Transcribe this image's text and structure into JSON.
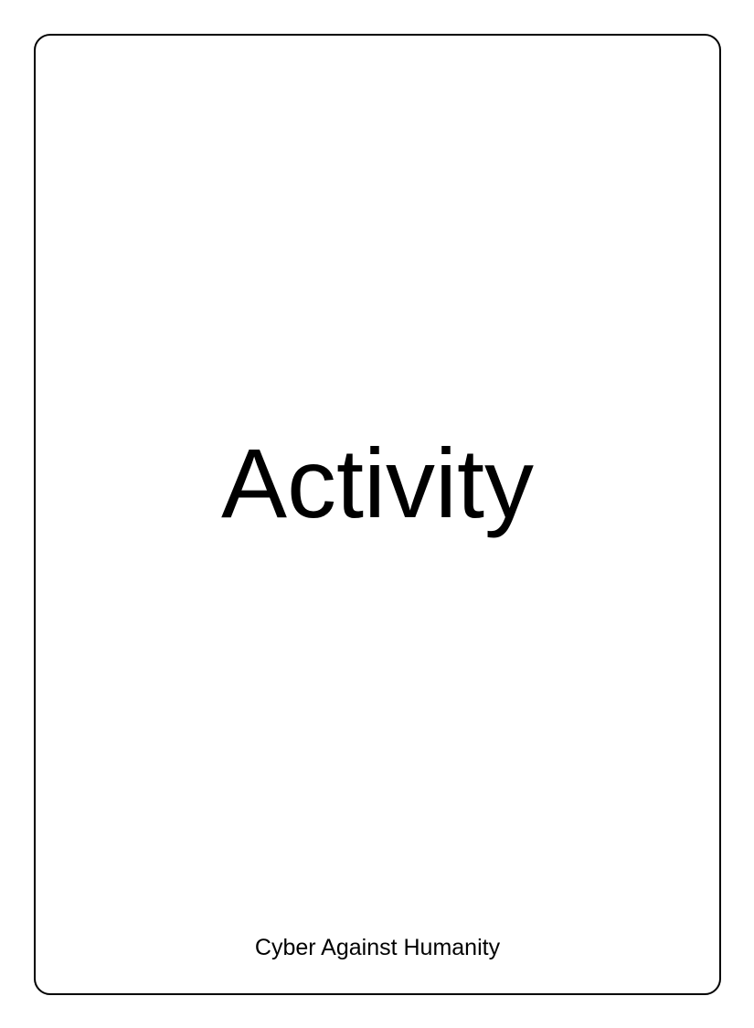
{
  "card": {
    "title": "Activity",
    "footer": "Cyber Against Humanity",
    "colors": {
      "border": "#000000",
      "background": "#ffffff",
      "text": "#000000"
    }
  }
}
